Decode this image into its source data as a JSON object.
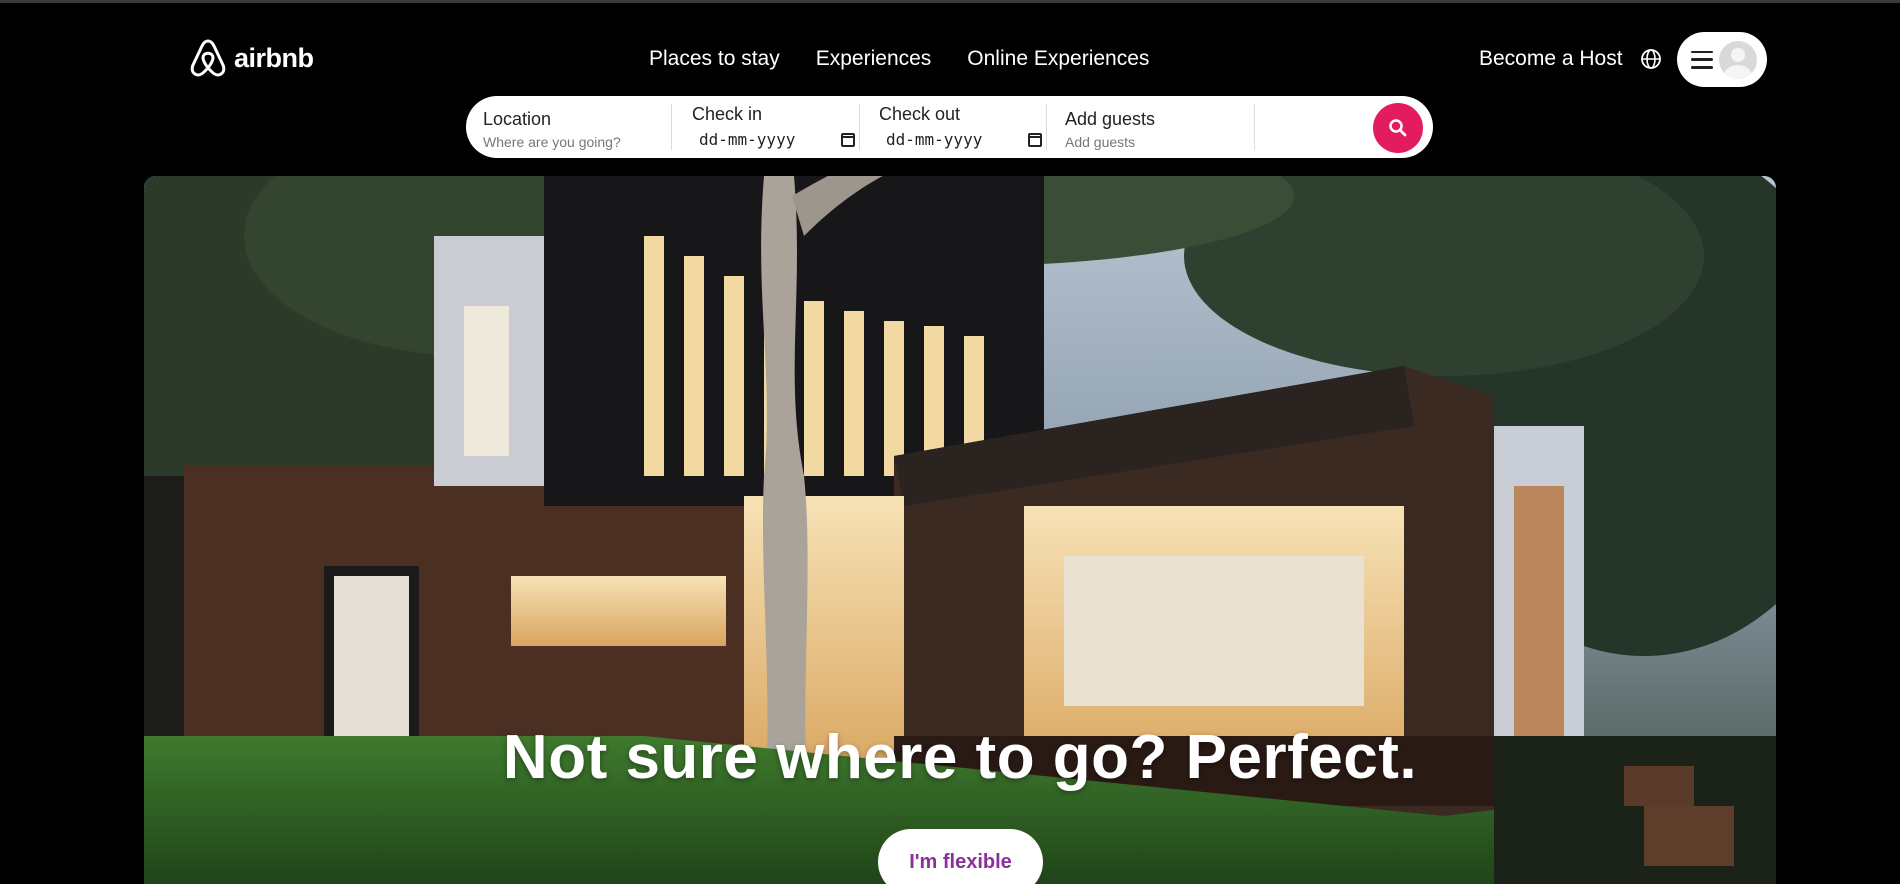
{
  "brand": {
    "name": "airbnb"
  },
  "nav": {
    "items": [
      {
        "label": "Places to stay"
      },
      {
        "label": "Experiences"
      },
      {
        "label": "Online Experiences"
      }
    ],
    "host_label": "Become a Host"
  },
  "search": {
    "location": {
      "label": "Location",
      "placeholder": "Where are you going?"
    },
    "checkin": {
      "label": "Check in",
      "value": "dd-mm-yyyy"
    },
    "checkout": {
      "label": "Check out",
      "value": "dd-mm-yyyy"
    },
    "guests": {
      "label": "Add guests",
      "placeholder": "Add guests"
    }
  },
  "hero": {
    "title": "Not sure where to go? Perfect.",
    "button_label": "I'm flexible"
  },
  "colors": {
    "accent": "#e31c5f",
    "flexible_text": "#8b2f9a",
    "background": "#000000"
  },
  "icons": [
    "airbnb-logo-icon",
    "globe-icon",
    "menu-icon",
    "avatar-icon",
    "calendar-icon",
    "search-icon"
  ]
}
